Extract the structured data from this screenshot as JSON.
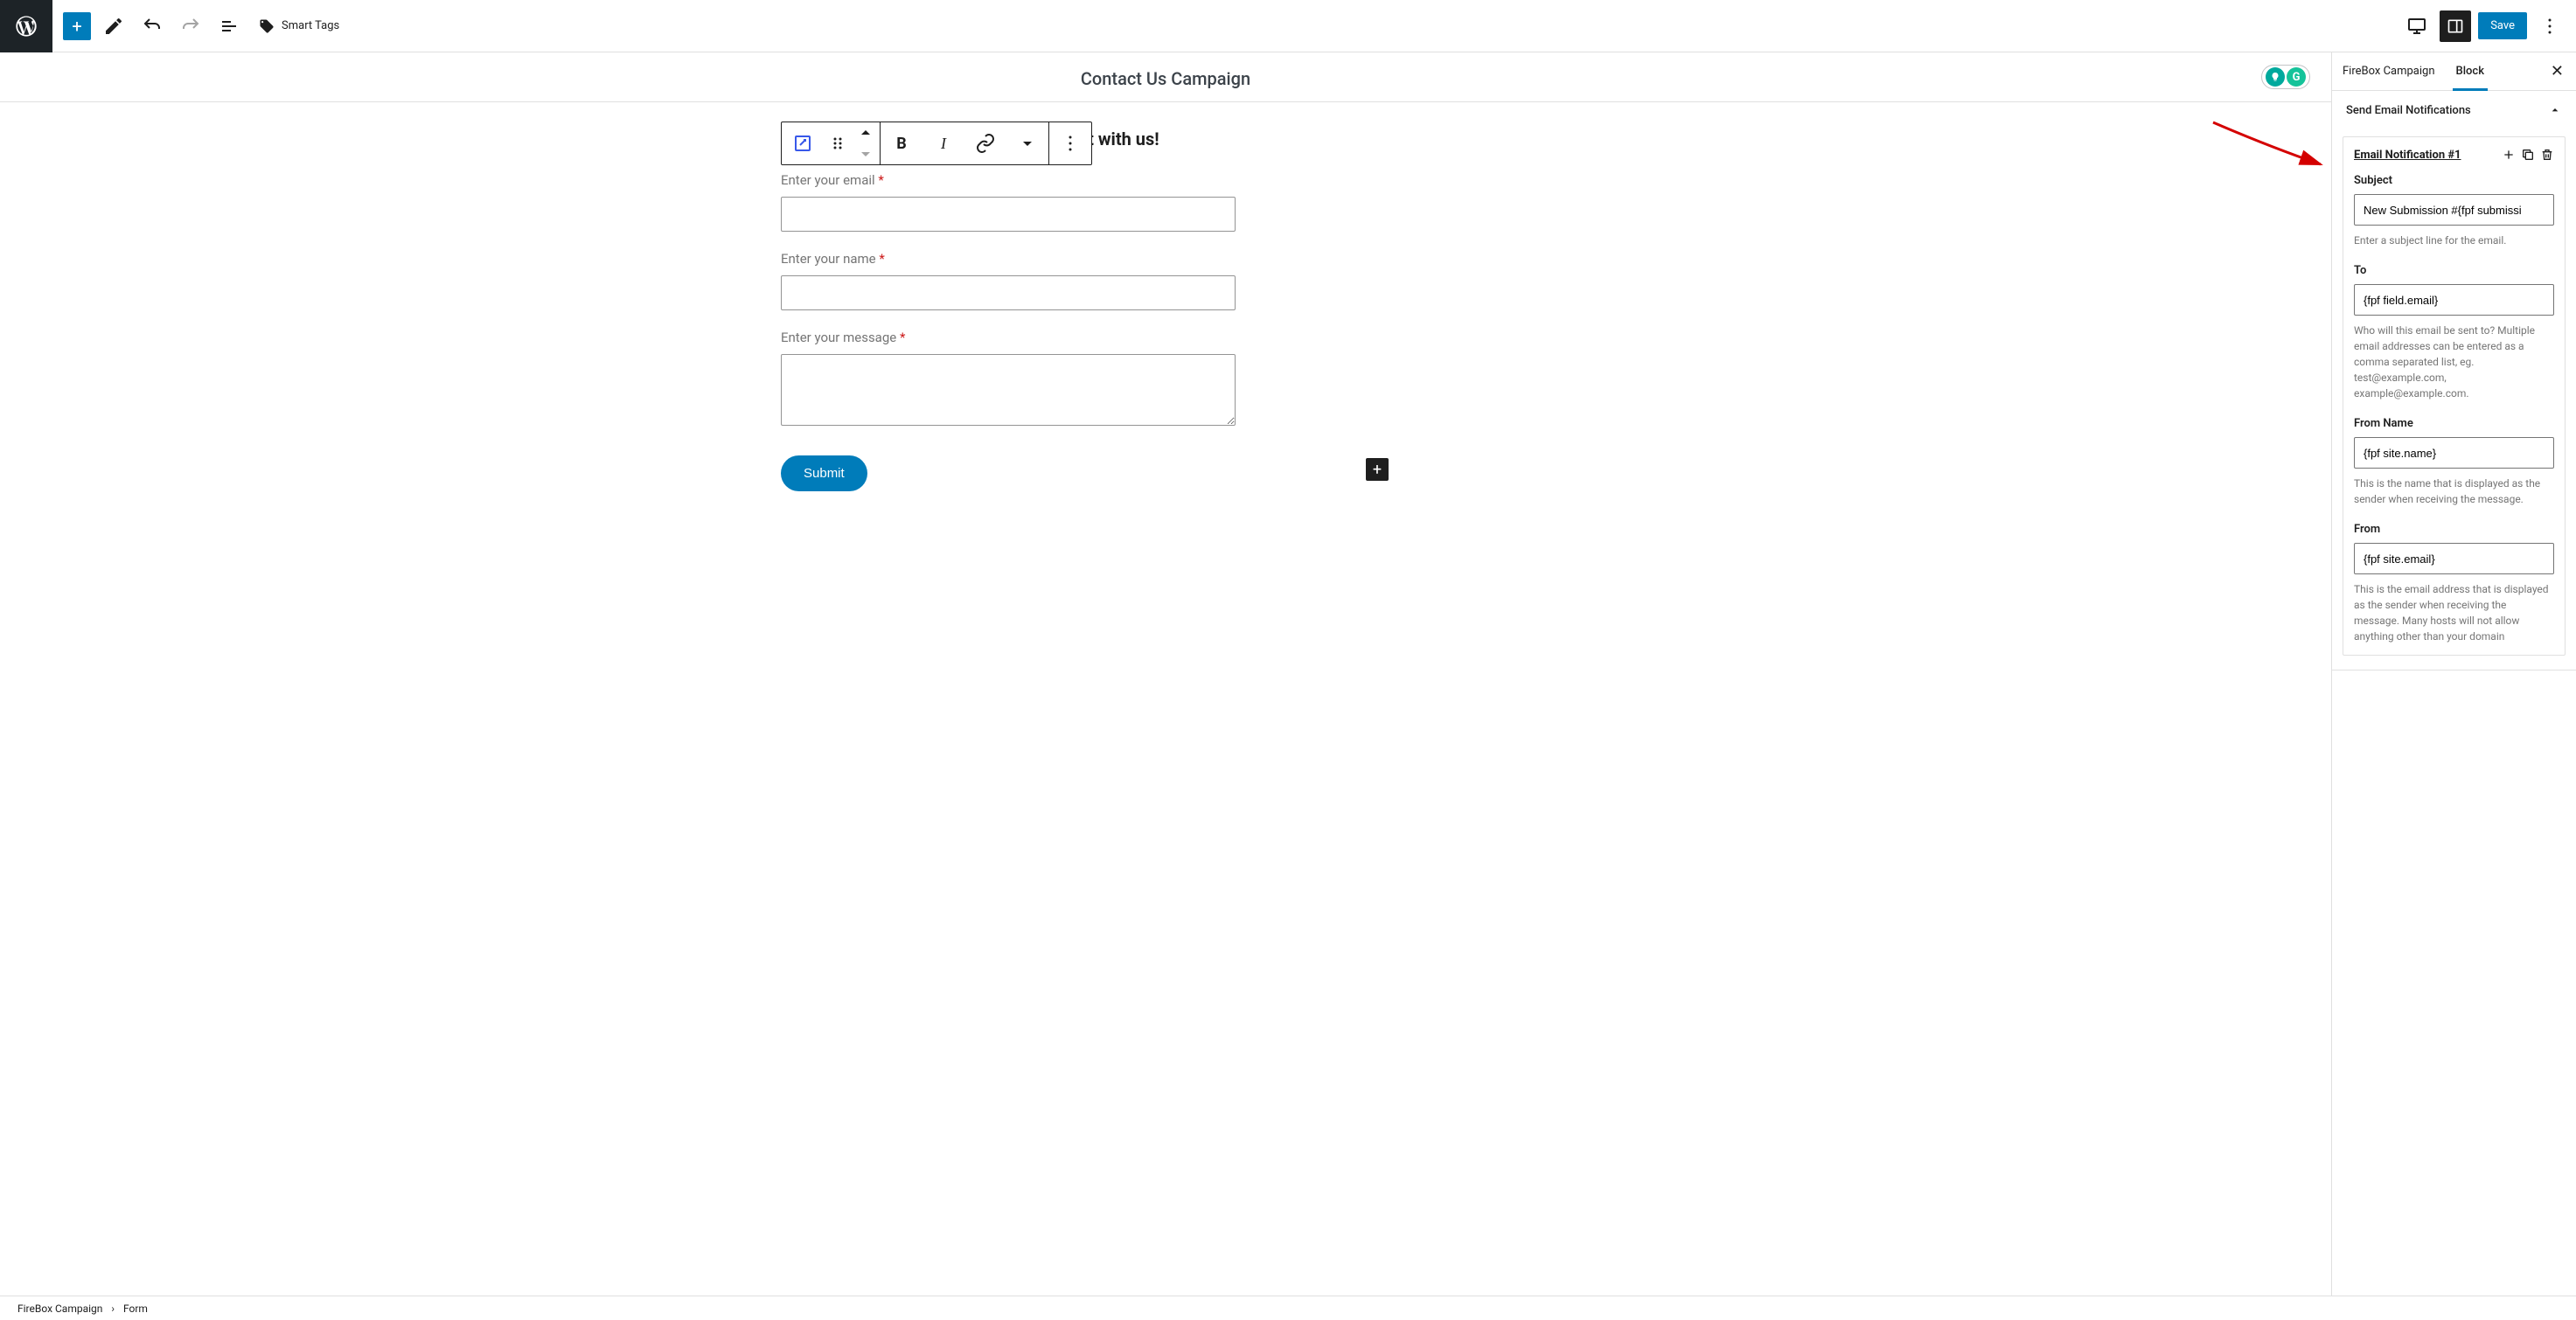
{
  "toolbar": {
    "smart_tags_label": "Smart Tags",
    "save_label": "Save"
  },
  "document": {
    "title": "Contact Us Campaign"
  },
  "form": {
    "heading_partial": "act with us!",
    "fields": [
      {
        "label": "Enter your email",
        "required": true
      },
      {
        "label": "Enter your name",
        "required": true
      },
      {
        "label": "Enter your message",
        "required": true
      }
    ],
    "submit_label": "Submit"
  },
  "sidebar": {
    "tabs": {
      "campaign": "FireBox Campaign",
      "block": "Block"
    },
    "section_title": "Send Email Notifications",
    "notification": {
      "title": "Email Notification #1",
      "subject": {
        "label": "Subject",
        "value": "New Submission #{fpf submissi",
        "help": "Enter a subject line for the email."
      },
      "to": {
        "label": "To",
        "value": "{fpf field.email}",
        "help": "Who will this email be sent to? Multiple email addresses can be entered as a comma separated list, eg. test@example.com, example@example.com."
      },
      "from_name": {
        "label": "From Name",
        "value": "{fpf site.name}",
        "help": "This is the name that is displayed as the sender when receiving the message."
      },
      "from": {
        "label": "From",
        "value": "{fpf site.email}",
        "help": "This is the email address that is displayed as the sender when receiving the message. Many hosts will not allow anything other than your domain"
      }
    }
  },
  "breadcrumb": {
    "root": "FireBox Campaign",
    "child": "Form"
  }
}
